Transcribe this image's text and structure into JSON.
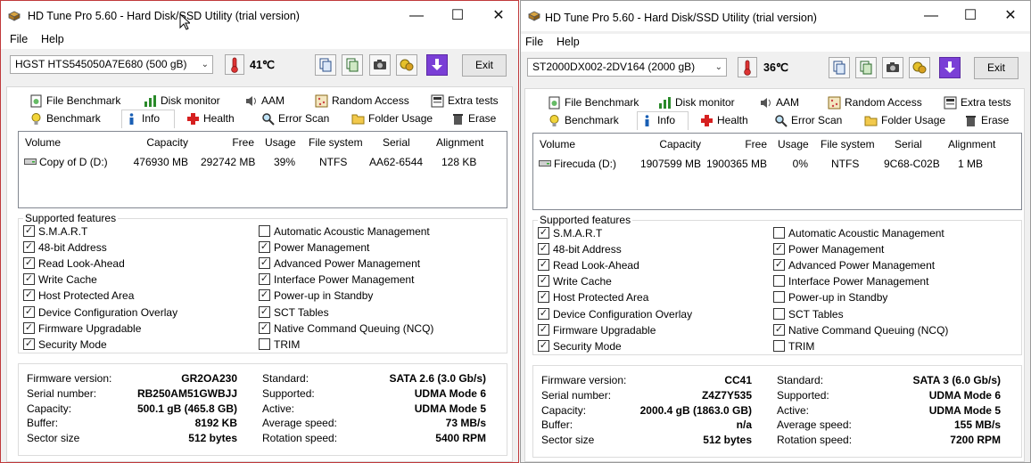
{
  "windows": [
    {
      "title": "HD Tune Pro 5.60 - Hard Disk/SSD Utility (trial version)",
      "menu": [
        "File",
        "Help"
      ],
      "drive": "HGST HTS545050A7E680 (500 gB)",
      "temperature": "41℃",
      "exit_label": "Exit",
      "tabs_row1": [
        "File Benchmark",
        "Disk monitor",
        "AAM",
        "Random Access",
        "Extra tests"
      ],
      "tabs_row2": [
        "Benchmark",
        "Info",
        "Health",
        "Error Scan",
        "Folder Usage",
        "Erase"
      ],
      "active_tab": "Info",
      "volume_headers": [
        "Volume",
        "Capacity",
        "Free",
        "Usage",
        "File system",
        "Serial",
        "Alignment"
      ],
      "volume_row": [
        "Copy of D (D:)",
        "476930 MB",
        "292742 MB",
        "39%",
        "NTFS",
        "AA62-6544",
        "128 KB"
      ],
      "features_title": "Supported features",
      "features_left": [
        {
          "label": "S.M.A.R.T",
          "checked": true
        },
        {
          "label": "48-bit Address",
          "checked": true
        },
        {
          "label": "Read Look-Ahead",
          "checked": true
        },
        {
          "label": "Write Cache",
          "checked": true
        },
        {
          "label": "Host Protected Area",
          "checked": true
        },
        {
          "label": "Device Configuration Overlay",
          "checked": true
        },
        {
          "label": "Firmware Upgradable",
          "checked": true
        },
        {
          "label": "Security Mode",
          "checked": true
        }
      ],
      "features_right": [
        {
          "label": "Automatic Acoustic Management",
          "checked": false
        },
        {
          "label": "Power Management",
          "checked": true
        },
        {
          "label": "Advanced Power Management",
          "checked": true
        },
        {
          "label": "Interface Power Management",
          "checked": true
        },
        {
          "label": "Power-up in Standby",
          "checked": true
        },
        {
          "label": "SCT Tables",
          "checked": true
        },
        {
          "label": "Native Command Queuing (NCQ)",
          "checked": true
        },
        {
          "label": "TRIM",
          "checked": false
        }
      ],
      "info_left": [
        {
          "label": "Firmware version:",
          "value": "GR2OA230"
        },
        {
          "label": "Serial number:",
          "value": "RB250AM51GWBJJ"
        },
        {
          "label": "Capacity:",
          "value": "500.1 gB (465.8 GB)"
        },
        {
          "label": "Buffer:",
          "value": "8192 KB"
        },
        {
          "label": "Sector size",
          "value": "512 bytes"
        }
      ],
      "info_right": [
        {
          "label": "Standard:",
          "value": "SATA 2.6 (3.0 Gb/s)"
        },
        {
          "label": "Supported:",
          "value": "UDMA Mode 6"
        },
        {
          "label": "Active:",
          "value": "UDMA Mode 5"
        },
        {
          "label": "Average speed:",
          "value": "73 MB/s"
        },
        {
          "label": "Rotation speed:",
          "value": "5400 RPM"
        }
      ]
    },
    {
      "title": "HD Tune Pro 5.60 - Hard Disk/SSD Utility (trial version)",
      "menu": [
        "File",
        "Help"
      ],
      "drive": "ST2000DX002-2DV164 (2000 gB)",
      "temperature": "36℃",
      "exit_label": "Exit",
      "tabs_row1": [
        "File Benchmark",
        "Disk monitor",
        "AAM",
        "Random Access",
        "Extra tests"
      ],
      "tabs_row2": [
        "Benchmark",
        "Info",
        "Health",
        "Error Scan",
        "Folder Usage",
        "Erase"
      ],
      "active_tab": "Info",
      "volume_headers": [
        "Volume",
        "Capacity",
        "Free",
        "Usage",
        "File system",
        "Serial",
        "Alignment"
      ],
      "volume_row": [
        "Firecuda (D:)",
        "1907599 MB",
        "1900365 MB",
        "0%",
        "NTFS",
        "9C68-C02B",
        "1 MB"
      ],
      "features_title": "Supported features",
      "features_left": [
        {
          "label": "S.M.A.R.T",
          "checked": true
        },
        {
          "label": "48-bit Address",
          "checked": true
        },
        {
          "label": "Read Look-Ahead",
          "checked": true
        },
        {
          "label": "Write Cache",
          "checked": true
        },
        {
          "label": "Host Protected Area",
          "checked": true
        },
        {
          "label": "Device Configuration Overlay",
          "checked": true
        },
        {
          "label": "Firmware Upgradable",
          "checked": true
        },
        {
          "label": "Security Mode",
          "checked": true
        }
      ],
      "features_right": [
        {
          "label": "Automatic Acoustic Management",
          "checked": false
        },
        {
          "label": "Power Management",
          "checked": true
        },
        {
          "label": "Advanced Power Management",
          "checked": true
        },
        {
          "label": "Interface Power Management",
          "checked": false
        },
        {
          "label": "Power-up in Standby",
          "checked": false
        },
        {
          "label": "SCT Tables",
          "checked": false
        },
        {
          "label": "Native Command Queuing (NCQ)",
          "checked": true
        },
        {
          "label": "TRIM",
          "checked": false
        }
      ],
      "info_left": [
        {
          "label": "Firmware version:",
          "value": "CC41"
        },
        {
          "label": "Serial number:",
          "value": "Z4Z7Y535"
        },
        {
          "label": "Capacity:",
          "value": "2000.4 gB (1863.0 GB)"
        },
        {
          "label": "Buffer:",
          "value": "n/a"
        },
        {
          "label": "Sector size",
          "value": "512 bytes"
        }
      ],
      "info_right": [
        {
          "label": "Standard:",
          "value": "SATA 3 (6.0 Gb/s)"
        },
        {
          "label": "Supported:",
          "value": "UDMA Mode 6"
        },
        {
          "label": "Active:",
          "value": "UDMA Mode 5"
        },
        {
          "label": "Average speed:",
          "value": "155 MB/s"
        },
        {
          "label": "Rotation speed:",
          "value": "7200 RPM"
        }
      ]
    }
  ]
}
